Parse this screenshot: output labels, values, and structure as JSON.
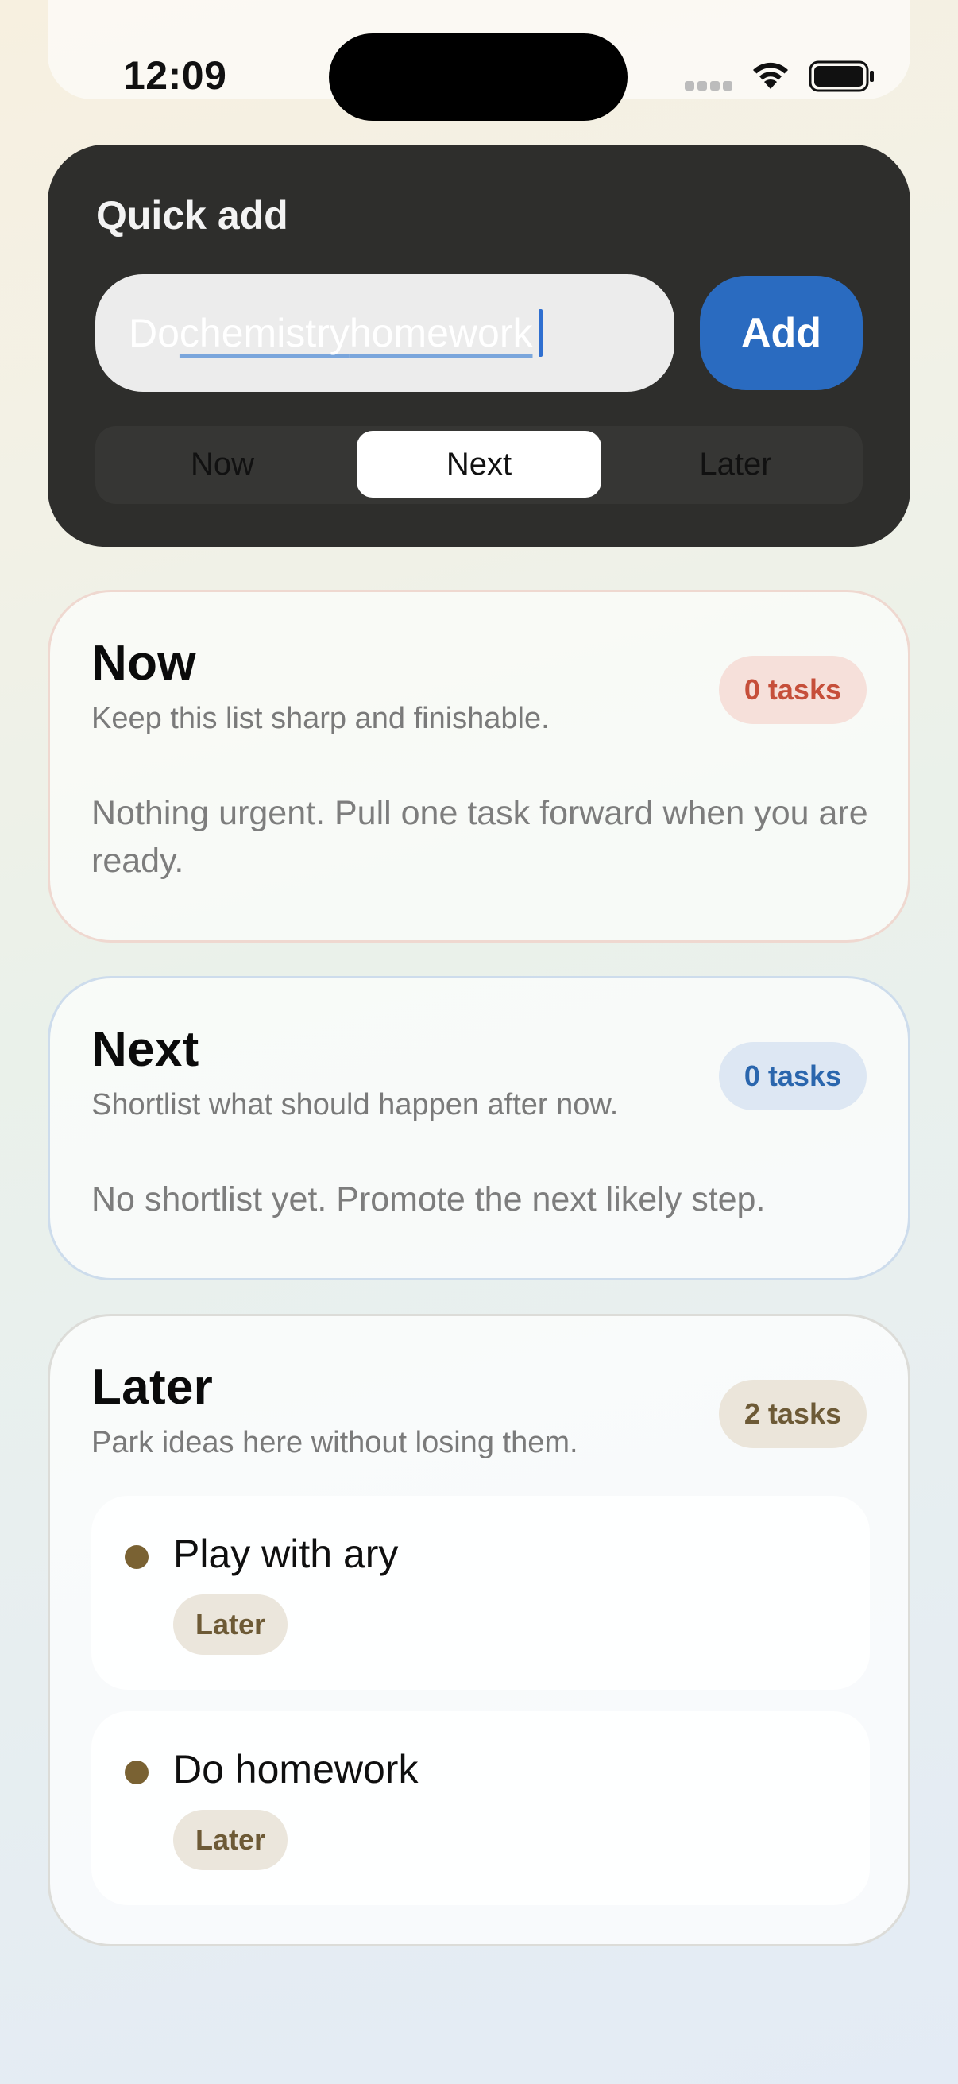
{
  "summary": {
    "counts": [
      "0",
      "0",
      "0",
      "2"
    ]
  },
  "status_bar": {
    "time": "12:09"
  },
  "quick_add": {
    "title": "Quick add",
    "input": {
      "word1": "Do ",
      "word2": "chemistry",
      "space": " ",
      "word3": "homework"
    },
    "add_label": "Add",
    "segments": [
      "Now",
      "Next",
      "Later"
    ],
    "selected_segment": "Next"
  },
  "lists": {
    "now": {
      "title": "Now",
      "subtitle": "Keep this list sharp and finishable.",
      "badge": "0 tasks",
      "empty": "Nothing urgent. Pull one task forward when you are ready."
    },
    "next": {
      "title": "Next",
      "subtitle": "Shortlist what should happen after now.",
      "badge": "0 tasks",
      "empty": "No shortlist yet. Promote the next likely step."
    },
    "later": {
      "title": "Later",
      "subtitle": "Park ideas here without losing them.",
      "badge": "2 tasks",
      "tasks": [
        {
          "title": "Play with ary",
          "tag": "Later"
        },
        {
          "title": "Do homework",
          "tag": "Later"
        }
      ]
    }
  },
  "colors": {
    "accent_blue": "#2a6bc0",
    "now_red": "#c64f3a",
    "next_blue": "#2a66ad",
    "later_brown": "#6d5a36",
    "quick_card_bg": "#2e2e2c"
  }
}
